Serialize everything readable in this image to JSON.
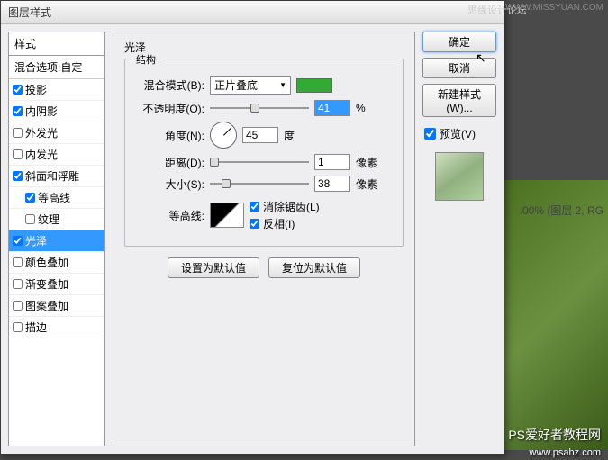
{
  "titlebar": {
    "title": "图层样式"
  },
  "watermarks": {
    "site1": "思缘设计论坛",
    "site1url": "WWW.MISSYUAN.COM",
    "site2": "PS爱好者教程网",
    "site2url": "www.psahz.com"
  },
  "bg": {
    "title": ".00% (图层 2, RG"
  },
  "left": {
    "header": "样式",
    "subheader": "混合选项:自定",
    "items": [
      {
        "label": "投影",
        "checked": true,
        "indent": false
      },
      {
        "label": "内阴影",
        "checked": true,
        "indent": false
      },
      {
        "label": "外发光",
        "checked": false,
        "indent": false
      },
      {
        "label": "内发光",
        "checked": false,
        "indent": false
      },
      {
        "label": "斜面和浮雕",
        "checked": true,
        "indent": false
      },
      {
        "label": "等高线",
        "checked": true,
        "indent": true
      },
      {
        "label": "纹理",
        "checked": false,
        "indent": true
      },
      {
        "label": "光泽",
        "checked": true,
        "indent": false,
        "selected": true
      },
      {
        "label": "颜色叠加",
        "checked": false,
        "indent": false
      },
      {
        "label": "渐变叠加",
        "checked": false,
        "indent": false
      },
      {
        "label": "图案叠加",
        "checked": false,
        "indent": false
      },
      {
        "label": "描边",
        "checked": false,
        "indent": false
      }
    ]
  },
  "center": {
    "title": "光泽",
    "group": "结构",
    "blend_label": "混合模式(B):",
    "blend_value": "正片叠底",
    "color": "#33aa33",
    "opacity_label": "不透明度(O):",
    "opacity_value": "41",
    "opacity_unit": "%",
    "angle_label": "角度(N):",
    "angle_value": "45",
    "angle_unit": "度",
    "distance_label": "距离(D):",
    "distance_value": "1",
    "distance_unit": "像素",
    "size_label": "大小(S):",
    "size_value": "38",
    "size_unit": "像素",
    "contour_label": "等高线:",
    "antialias_label": "消除锯齿(L)",
    "invert_label": "反相(I)",
    "btn_default": "设置为默认值",
    "btn_reset": "复位为默认值"
  },
  "right": {
    "ok": "确定",
    "cancel": "取消",
    "newstyle": "新建样式(W)...",
    "preview": "预览(V)"
  }
}
